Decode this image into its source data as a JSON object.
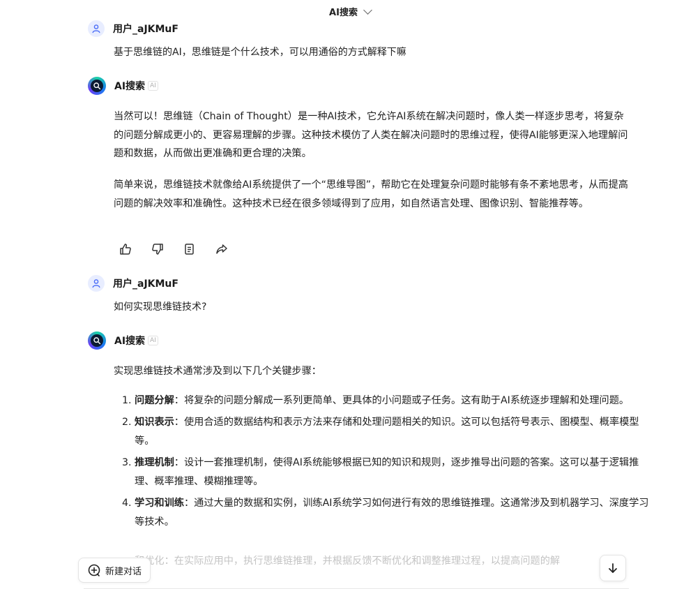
{
  "header": {
    "title": "AI搜索"
  },
  "conversation": {
    "turn1": {
      "user_name": "用户_aJKMuF",
      "user_text": "基于思维链的AI，思维链是个什么技术，可以用通俗的方式解释下嘛",
      "ai_name": "AI搜索",
      "ai_badge": "AI",
      "ai_paragraphs": [
        "当然可以！思维链（Chain of Thought）是一种AI技术，它允许AI系统在解决问题时，像人类一样逐步思考，将复杂的问题分解成更小的、更容易理解的步骤。这种技术模仿了人类在解决问题时的思维过程，使得AI能够更深入地理解问题和数据，从而做出更准确和更合理的决策。",
        "简单来说，思维链技术就像给AI系统提供了一个“思维导图”，帮助它在处理复杂问题时能够有条不紊地思考，从而提高问题的解决效率和准确性。这种技术已经在很多领域得到了应用，如自然语言处理、图像识别、智能推荐等。"
      ],
      "actions": [
        "like-icon",
        "dislike-icon",
        "copy-icon",
        "share-icon"
      ]
    },
    "turn2": {
      "user_name": "用户_aJKMuF",
      "user_text": "如何实现思维链技术?",
      "ai_name": "AI搜索",
      "ai_badge": "AI",
      "ai_intro": "实现思维链技术通常涉及到以下几个关键步骤：",
      "steps": [
        {
          "title": "问题分解",
          "sep": "：",
          "text": "将复杂的问题分解成一系列更简单、更具体的小问题或子任务。这有助于AI系统逐步理解和处理问题。"
        },
        {
          "title": "知识表示",
          "sep": "：",
          "text": "使用合适的数据结构和表示方法来存储和处理问题相关的知识。这可以包括符号表示、图模型、概率模型等。"
        },
        {
          "title": "推理机制",
          "sep": "：",
          "text": "设计一套推理机制，使得AI系统能够根据已知的知识和规则，逐步推导出问题的答案。这可以基于逻辑推理、概率推理、模糊推理等。"
        },
        {
          "title": "学习和训练",
          "sep": "：",
          "text": "通过大量的数据和实例，训练AI系统学习如何进行有效的思维链推理。这通常涉及到机器学习、深度学习等技术。"
        }
      ],
      "faded_line": "和优化：在实际应用中，执行思维链推理，并根据反馈不断优化和调整推理过程，以提高问题的解"
    }
  },
  "footer": {
    "new_chat_label": "新建对话"
  },
  "colors": {
    "accent": "#4a6cf7",
    "text": "#222222",
    "muted": "#c4c4c4"
  }
}
